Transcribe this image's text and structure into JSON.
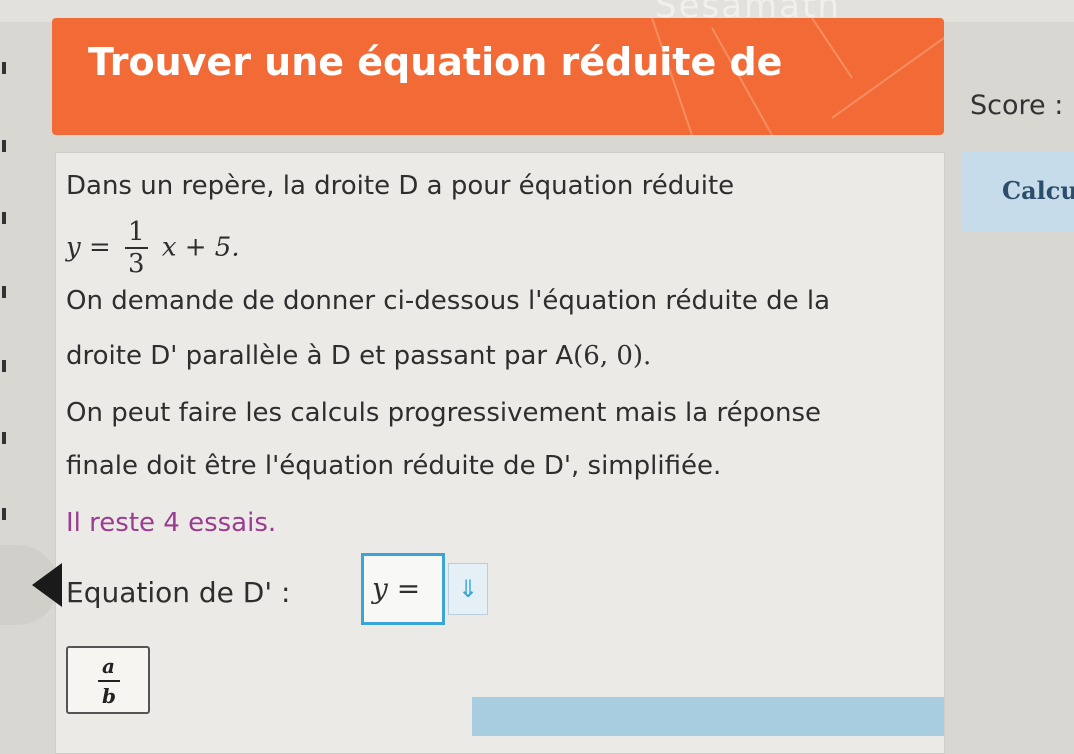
{
  "brand": "Sesamath",
  "header": {
    "title": "Trouver une équation réduite de"
  },
  "sidebar": {
    "score_label": "Score :",
    "calc_label": "Calcu"
  },
  "exercise": {
    "intro": "Dans un repère, la droite D a pour équation réduite",
    "equation": {
      "lhs": "y =",
      "numerator": "1",
      "denominator": "3",
      "rest": "x + 5."
    },
    "line3": "On demande de donner ci-dessous l'équation réduite de la",
    "line4_text": "droite D' parallèle à D et passant par ",
    "line4_point_label": "A",
    "line4_point_coords": "(6, 0).",
    "line5": "On peut faire les calculs progressivement mais la réponse",
    "line6": "finale doit être l'équation réduite de D', simplifiée.",
    "attempts": "Il reste 4 essais.",
    "answer_label": "Equation de D' :",
    "answer_prefix": "y =",
    "dropdown_icon": "⇓"
  },
  "toolbar": {
    "fraction_num": "a",
    "fraction_den": "b"
  },
  "colors": {
    "header": "#f26b37",
    "accent": "#3ba4d9",
    "attempts": "#9a3d91",
    "card": "#eceae6"
  }
}
